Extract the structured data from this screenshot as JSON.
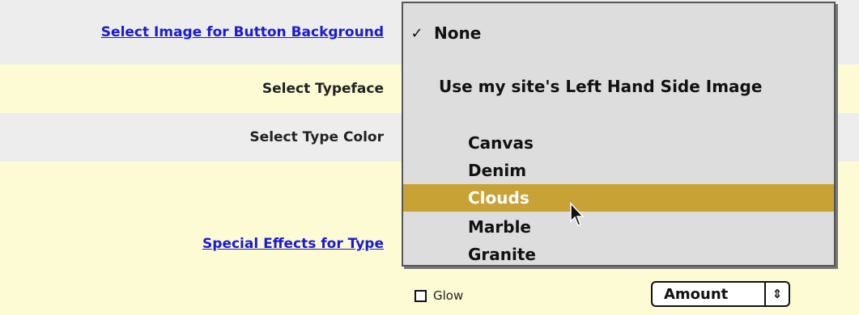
{
  "rows": {
    "button_background_label": "Select Image for Button Background",
    "typeface_label": "Select Typeface",
    "type_color_label": "Select Type Color",
    "special_effects_label": "Special Effects for Type"
  },
  "effects": {
    "glow_label": "Glow",
    "glow_checked": false,
    "amount_label": "Amount",
    "amount_arrows": "⇕"
  },
  "menu": {
    "checkmark": "✓",
    "items": [
      {
        "label": "None",
        "checked": true
      },
      {
        "label": "Use my site's Left Hand Side Image"
      },
      {
        "label": "Canvas"
      },
      {
        "label": "Denim"
      },
      {
        "label": "Clouds",
        "highlighted": true
      },
      {
        "label": "Marble"
      },
      {
        "label": "Granite"
      }
    ],
    "highlight_color": "#c9a236"
  },
  "colors": {
    "link": "#1a1ad6",
    "row_gray": "#ededed",
    "row_yellow": "#fdfbd4"
  }
}
